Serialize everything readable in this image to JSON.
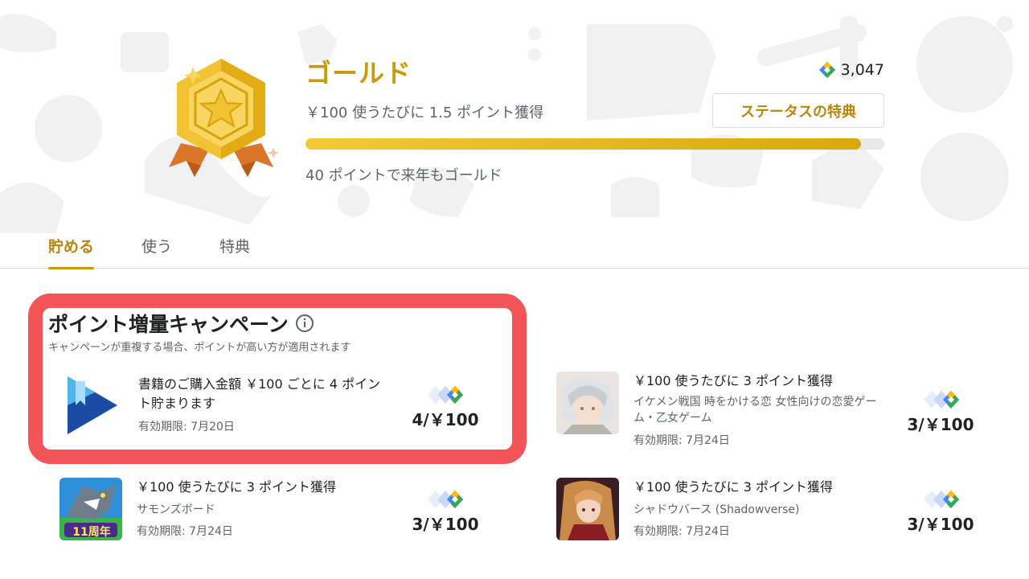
{
  "header": {
    "tier_name": "ゴールド",
    "rate_text": "￥100 使うたびに 1.5 ポイント獲得",
    "progress_fraction": 0.96,
    "progress_note": "40 ポイントで来年もゴールド",
    "points_balance": "3,047",
    "benefit_button": "ステータスの特典"
  },
  "tabs": [
    {
      "label": "貯める",
      "active": true
    },
    {
      "label": "使う",
      "active": false
    },
    {
      "label": "特典",
      "active": false
    }
  ],
  "campaign": {
    "title": "ポイント増量キャンペーン",
    "subtitle": "キャンペーンが重複する場合、ポイントが高い方が適用されます",
    "offers": [
      {
        "line1a": "書籍のご購入金額 ￥100 ごとに 4 ポイン",
        "line1b": "ト貯まります",
        "expiry": "有効期限: 7月20日",
        "rate": "4/￥100",
        "thumb_icon": "play-books-icon"
      },
      {
        "line1a": "￥100 使うたびに 3 ポイント獲得",
        "line2a": "イケメン戦国 時をかける恋 女性向けの恋愛ゲー",
        "line2b": "ム・乙女ゲーム",
        "expiry": "有効期限: 7月24日",
        "rate": "3/￥100",
        "thumb_icon": "ikemen-sengoku-app-icon"
      },
      {
        "line1a": "￥100 使うたびに 3 ポイント獲得",
        "line2a": "サモンズボード",
        "expiry": "有効期限: 7月24日",
        "rate": "3/￥100",
        "thumb_icon": "summons-board-app-icon",
        "thumb_badge": "11周年"
      },
      {
        "line1a": "￥100 使うたびに 3 ポイント獲得",
        "line2a": "シャドウバース (Shadowverse)",
        "expiry": "有効期限: 7月24日",
        "rate": "3/￥100",
        "thumb_icon": "shadowverse-app-icon"
      }
    ]
  },
  "colors": {
    "gold": "#c99a0b",
    "highlight_red": "#f25457"
  }
}
